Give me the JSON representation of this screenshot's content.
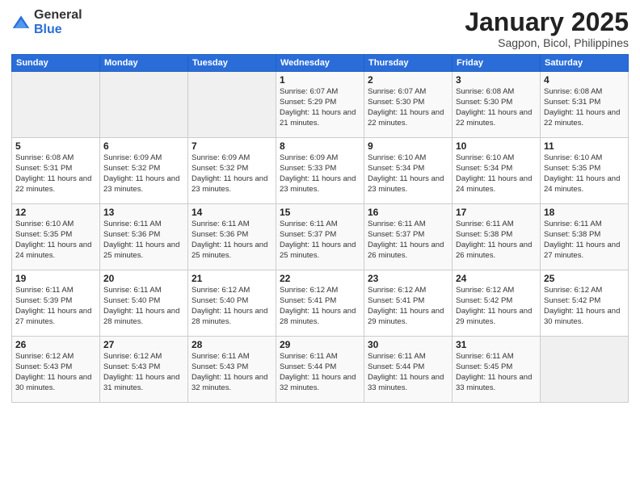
{
  "header": {
    "logo_general": "General",
    "logo_blue": "Blue",
    "month": "January 2025",
    "location": "Sagpon, Bicol, Philippines"
  },
  "weekdays": [
    "Sunday",
    "Monday",
    "Tuesday",
    "Wednesday",
    "Thursday",
    "Friday",
    "Saturday"
  ],
  "weeks": [
    [
      {
        "day": "",
        "info": ""
      },
      {
        "day": "",
        "info": ""
      },
      {
        "day": "",
        "info": ""
      },
      {
        "day": "1",
        "info": "Sunrise: 6:07 AM\nSunset: 5:29 PM\nDaylight: 11 hours\nand 21 minutes."
      },
      {
        "day": "2",
        "info": "Sunrise: 6:07 AM\nSunset: 5:30 PM\nDaylight: 11 hours\nand 22 minutes."
      },
      {
        "day": "3",
        "info": "Sunrise: 6:08 AM\nSunset: 5:30 PM\nDaylight: 11 hours\nand 22 minutes."
      },
      {
        "day": "4",
        "info": "Sunrise: 6:08 AM\nSunset: 5:31 PM\nDaylight: 11 hours\nand 22 minutes."
      }
    ],
    [
      {
        "day": "5",
        "info": "Sunrise: 6:08 AM\nSunset: 5:31 PM\nDaylight: 11 hours\nand 22 minutes."
      },
      {
        "day": "6",
        "info": "Sunrise: 6:09 AM\nSunset: 5:32 PM\nDaylight: 11 hours\nand 23 minutes."
      },
      {
        "day": "7",
        "info": "Sunrise: 6:09 AM\nSunset: 5:32 PM\nDaylight: 11 hours\nand 23 minutes."
      },
      {
        "day": "8",
        "info": "Sunrise: 6:09 AM\nSunset: 5:33 PM\nDaylight: 11 hours\nand 23 minutes."
      },
      {
        "day": "9",
        "info": "Sunrise: 6:10 AM\nSunset: 5:34 PM\nDaylight: 11 hours\nand 23 minutes."
      },
      {
        "day": "10",
        "info": "Sunrise: 6:10 AM\nSunset: 5:34 PM\nDaylight: 11 hours\nand 24 minutes."
      },
      {
        "day": "11",
        "info": "Sunrise: 6:10 AM\nSunset: 5:35 PM\nDaylight: 11 hours\nand 24 minutes."
      }
    ],
    [
      {
        "day": "12",
        "info": "Sunrise: 6:10 AM\nSunset: 5:35 PM\nDaylight: 11 hours\nand 24 minutes."
      },
      {
        "day": "13",
        "info": "Sunrise: 6:11 AM\nSunset: 5:36 PM\nDaylight: 11 hours\nand 25 minutes."
      },
      {
        "day": "14",
        "info": "Sunrise: 6:11 AM\nSunset: 5:36 PM\nDaylight: 11 hours\nand 25 minutes."
      },
      {
        "day": "15",
        "info": "Sunrise: 6:11 AM\nSunset: 5:37 PM\nDaylight: 11 hours\nand 25 minutes."
      },
      {
        "day": "16",
        "info": "Sunrise: 6:11 AM\nSunset: 5:37 PM\nDaylight: 11 hours\nand 26 minutes."
      },
      {
        "day": "17",
        "info": "Sunrise: 6:11 AM\nSunset: 5:38 PM\nDaylight: 11 hours\nand 26 minutes."
      },
      {
        "day": "18",
        "info": "Sunrise: 6:11 AM\nSunset: 5:38 PM\nDaylight: 11 hours\nand 27 minutes."
      }
    ],
    [
      {
        "day": "19",
        "info": "Sunrise: 6:11 AM\nSunset: 5:39 PM\nDaylight: 11 hours\nand 27 minutes."
      },
      {
        "day": "20",
        "info": "Sunrise: 6:11 AM\nSunset: 5:40 PM\nDaylight: 11 hours\nand 28 minutes."
      },
      {
        "day": "21",
        "info": "Sunrise: 6:12 AM\nSunset: 5:40 PM\nDaylight: 11 hours\nand 28 minutes."
      },
      {
        "day": "22",
        "info": "Sunrise: 6:12 AM\nSunset: 5:41 PM\nDaylight: 11 hours\nand 28 minutes."
      },
      {
        "day": "23",
        "info": "Sunrise: 6:12 AM\nSunset: 5:41 PM\nDaylight: 11 hours\nand 29 minutes."
      },
      {
        "day": "24",
        "info": "Sunrise: 6:12 AM\nSunset: 5:42 PM\nDaylight: 11 hours\nand 29 minutes."
      },
      {
        "day": "25",
        "info": "Sunrise: 6:12 AM\nSunset: 5:42 PM\nDaylight: 11 hours\nand 30 minutes."
      }
    ],
    [
      {
        "day": "26",
        "info": "Sunrise: 6:12 AM\nSunset: 5:43 PM\nDaylight: 11 hours\nand 30 minutes."
      },
      {
        "day": "27",
        "info": "Sunrise: 6:12 AM\nSunset: 5:43 PM\nDaylight: 11 hours\nand 31 minutes."
      },
      {
        "day": "28",
        "info": "Sunrise: 6:11 AM\nSunset: 5:43 PM\nDaylight: 11 hours\nand 32 minutes."
      },
      {
        "day": "29",
        "info": "Sunrise: 6:11 AM\nSunset: 5:44 PM\nDaylight: 11 hours\nand 32 minutes."
      },
      {
        "day": "30",
        "info": "Sunrise: 6:11 AM\nSunset: 5:44 PM\nDaylight: 11 hours\nand 33 minutes."
      },
      {
        "day": "31",
        "info": "Sunrise: 6:11 AM\nSunset: 5:45 PM\nDaylight: 11 hours\nand 33 minutes."
      },
      {
        "day": "",
        "info": ""
      }
    ]
  ]
}
